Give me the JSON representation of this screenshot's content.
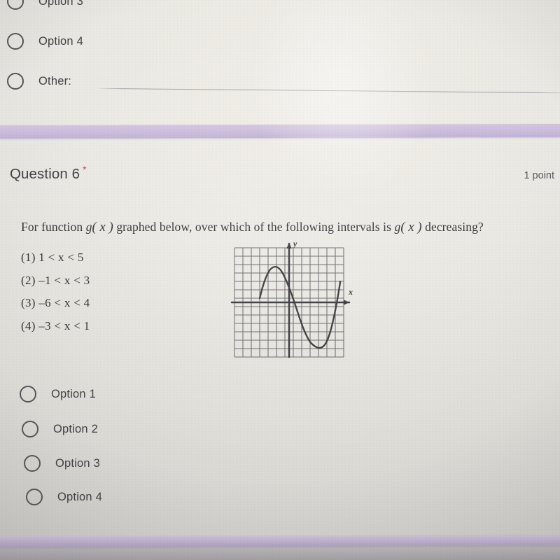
{
  "meta": {
    "app": "Google Forms quiz (photographed screen)",
    "accent_purple": "#cbbcdc",
    "required_marker_color": "#c2434a",
    "page_background": "#eceae4"
  },
  "previous_question": {
    "options": [
      {
        "label": "Option 3",
        "selected": false
      },
      {
        "label": "Option 4",
        "selected": false
      },
      {
        "label": "Other:",
        "selected": false,
        "has_text_input": true,
        "input_value": ""
      }
    ]
  },
  "question": {
    "title": "Question 6",
    "required_marker": "*",
    "points": "1 point",
    "prompt_parts": {
      "p1": "For function ",
      "g1": "g",
      "x1": "( x )",
      "p2": " graphed below, over which of the following intervals is ",
      "g2": "g",
      "x2": "( x )",
      "p3": " decreasing?"
    },
    "prompt_plain": "For function g(x) graphed below, over which of the following intervals is g(x) decreasing?",
    "answer_choices": [
      "(1) 1 < x < 5",
      "(2) –1 < x < 3",
      "(3) –6 < x < 4",
      "(4) –3 < x < 1"
    ],
    "options": [
      {
        "label": "Option 1",
        "selected": false
      },
      {
        "label": "Option 2",
        "selected": false
      },
      {
        "label": "Option 3",
        "selected": false
      },
      {
        "label": "Option 4",
        "selected": false
      }
    ]
  },
  "chart_data": {
    "type": "line",
    "title": "",
    "xlabel": "x",
    "ylabel": "y",
    "grid": true,
    "legend": false,
    "xlim": [
      -7,
      6
    ],
    "ylim": [
      -7,
      6
    ],
    "x_tick_step": 1,
    "y_tick_step": 1,
    "axis_arrows": [
      "x-positive",
      "y-positive"
    ],
    "description": "Cubic-like curve g(x): rises from left, local maximum near x = -2, falls through the origin region, local minimum near x = 3, then rises steeply.",
    "key_points": {
      "local_maximum": {
        "x": -2,
        "y": 3.7
      },
      "local_minimum": {
        "x": 3,
        "y": -5.8
      },
      "x_intercepts": [
        -4,
        0.7,
        5.1
      ]
    },
    "series": [
      {
        "name": "g(x)",
        "x": [
          -4.0,
          -3.6,
          -3.2,
          -2.8,
          -2.4,
          -2.0,
          -1.6,
          -1.2,
          -0.8,
          -0.4,
          0.0,
          0.4,
          0.8,
          1.2,
          1.6,
          2.0,
          2.4,
          2.8,
          3.2,
          3.6,
          4.0,
          4.4,
          4.8,
          5.2,
          5.6
        ],
        "y": [
          0.0,
          1.5,
          2.6,
          3.35,
          3.68,
          3.72,
          3.45,
          2.85,
          2.0,
          1.0,
          -0.1,
          -1.3,
          -2.5,
          -3.6,
          -4.5,
          -5.2,
          -5.6,
          -5.85,
          -5.9,
          -5.7,
          -5.1,
          -4.0,
          -2.4,
          -0.4,
          2.0
        ]
      }
    ]
  }
}
